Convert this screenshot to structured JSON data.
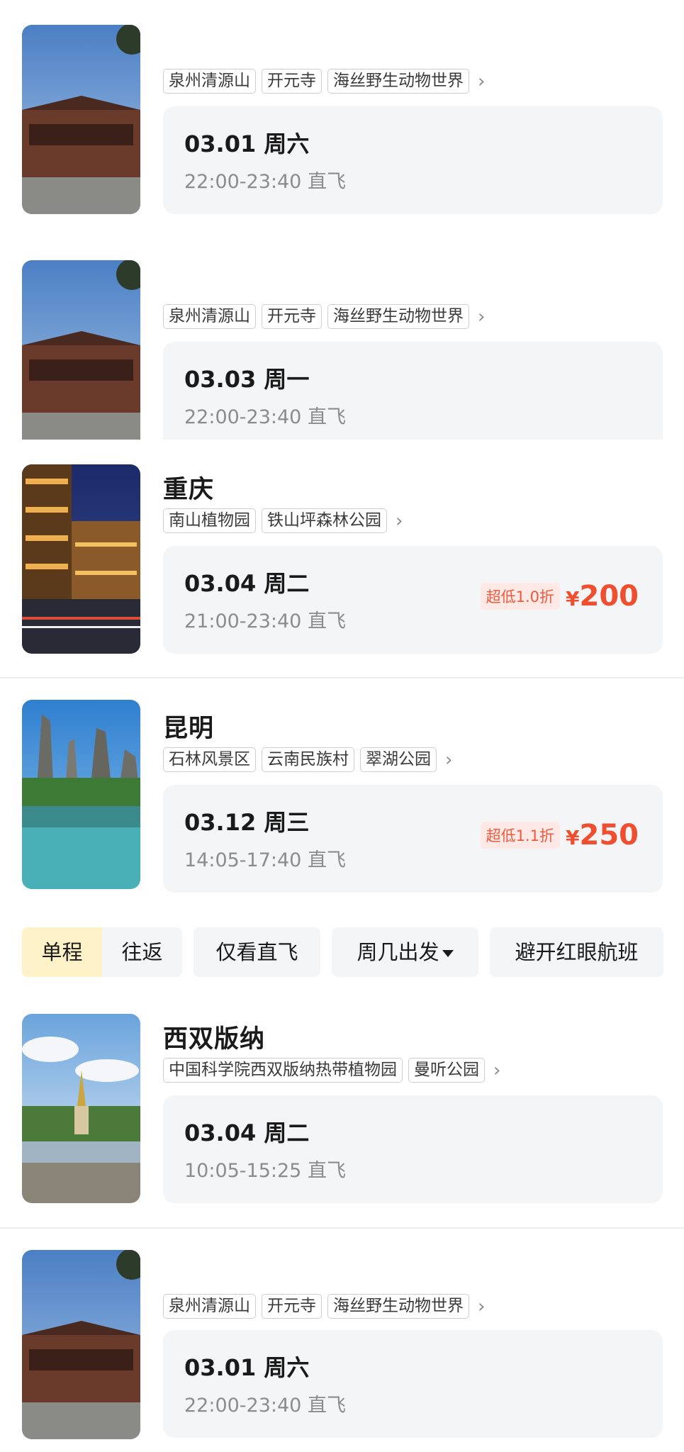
{
  "cards": [
    {
      "city": "",
      "tags": [
        "泉州清源山",
        "开元寺",
        "海丝野生动物世界"
      ],
      "date": "03.01 周六",
      "time": "22:00-23:40 直飞",
      "deal": null
    },
    {
      "city": "",
      "tags": [
        "泉州清源山",
        "开元寺",
        "海丝野生动物世界"
      ],
      "date": "03.03 周一",
      "time": "22:00-23:40 直飞",
      "deal": null
    },
    {
      "city": "重庆",
      "tags": [
        "南山植物园",
        "铁山坪森林公园"
      ],
      "date": "03.04 周二",
      "time": "21:00-23:40 直飞",
      "deal": {
        "badge": "超低1.0折",
        "currency": "¥",
        "price": "200"
      }
    },
    {
      "city": "昆明",
      "tags": [
        "石林风景区",
        "云南民族村",
        "翠湖公园"
      ],
      "date": "03.12 周三",
      "time": "14:05-17:40 直飞",
      "deal": {
        "badge": "超低1.1折",
        "currency": "¥",
        "price": "250"
      }
    },
    {
      "city": "西双版纳",
      "tags": [
        "中国科学院西双版纳热带植物园",
        "曼听公园"
      ],
      "date": "03.04 周二",
      "time": "10:05-15:25 直飞",
      "deal": null
    },
    {
      "city": "",
      "tags": [
        "泉州清源山",
        "开元寺",
        "海丝野生动物世界"
      ],
      "date": "03.01 周六",
      "time": "22:00-23:40 直飞",
      "deal": null
    }
  ],
  "filters": {
    "trip_oneway": "单程",
    "trip_roundtrip": "往返",
    "direct_only": "仅看直飞",
    "weekday": "周几出发",
    "avoid_redeye": "避开红眼航班"
  },
  "icons": {
    "tag_more": "chevron-right-icon",
    "dropdown": "caret-down-icon"
  },
  "colors": {
    "price_red": "#ef4f2e",
    "badge_bg": "#ffe9e6",
    "active_segment": "#fdf2c7",
    "panel_bg": "#f4f5f7"
  }
}
